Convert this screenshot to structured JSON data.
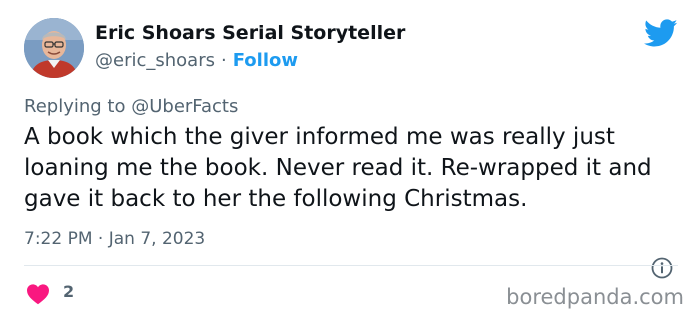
{
  "author": {
    "display_name": "Eric Shoars Serial Storyteller",
    "handle": "@eric_shoars",
    "separator": "·",
    "follow_label": "Follow"
  },
  "reply": {
    "prefix": "Replying to",
    "mention": "@UberFacts"
  },
  "tweet": {
    "text": "A book which the giver informed me was really just loaning me the book. Never read it. Re-wrapped it and gave it back to her the following Christmas.",
    "timestamp": "7:22 PM · Jan 7, 2023"
  },
  "engagement": {
    "like_count": "2"
  },
  "watermark": "boredpanda.com",
  "icons": {
    "brand": "twitter-bird-icon",
    "info": "info-icon",
    "like": "heart-icon"
  },
  "colors": {
    "accent": "#1d9bf0",
    "like": "#f91880",
    "muted_text": "#536471",
    "text": "#0f1419"
  }
}
